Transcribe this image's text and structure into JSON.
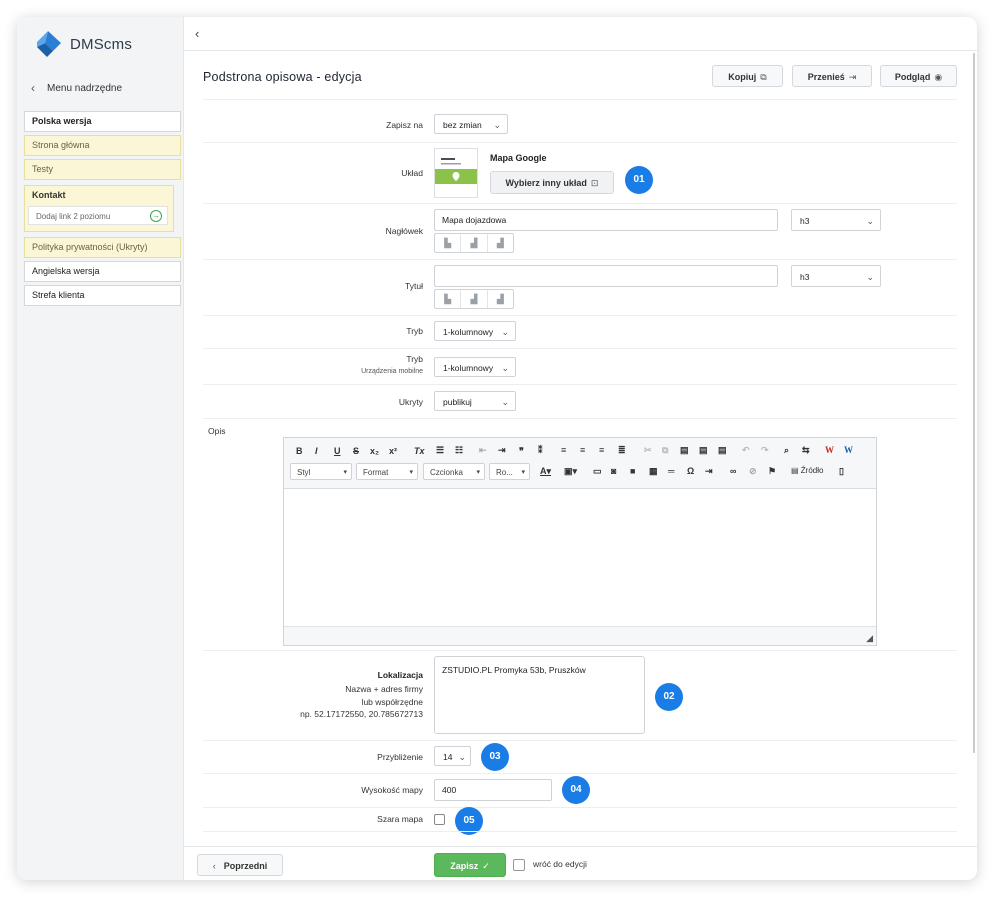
{
  "app": {
    "name": "DMScms"
  },
  "sidebar": {
    "back_label": "Menu nadrzędne",
    "items": [
      {
        "label": "Polska wersja"
      },
      {
        "label": "Strona główna"
      },
      {
        "label": "Testy"
      },
      {
        "label": "Kontakt"
      },
      {
        "label": "Dodaj link 2 poziomu"
      },
      {
        "label": "Polityka prywatności (Ukryty)"
      },
      {
        "label": "Angielska wersja"
      },
      {
        "label": "Strefa klienta"
      }
    ]
  },
  "header": {
    "title": "Podstrona opisowa - edycja",
    "copy_label": "Kopiuj",
    "move_label": "Przenieś",
    "preview_label": "Podgląd"
  },
  "form": {
    "save_to_label": "Zapisz na",
    "save_to_value": "bez zmian",
    "layout_label": "Układ",
    "layout_name": "Mapa Google",
    "choose_layout_label": "Wybierz inny układ",
    "heading_label": "Nagłówek",
    "heading_value": "Mapa dojazdowa",
    "heading_tag": "h3",
    "title_label": "Tytuł",
    "title_value": "",
    "title_tag": "h3",
    "mode_label": "Tryb",
    "mode_value": "1-kolumnowy",
    "mode_mobile_label": "Tryb",
    "mode_mobile_sub": "Urządzenia mobilne",
    "mode_mobile_value": "1-kolumnowy",
    "hidden_label": "Ukryty",
    "hidden_value": "publikuj",
    "description_label": "Opis",
    "location_label": "Lokalizacja",
    "location_hint1": "Nazwa + adres firmy",
    "location_hint2": "lub współrzędne",
    "location_hint3": "np. 52.17172550, 20.785672713",
    "location_value": "ZSTUDIO.PL Promyka 53b, Pruszków",
    "zoom_label": "Przybliżenie",
    "zoom_value": "14",
    "height_label": "Wysokość mapy",
    "height_value": "400",
    "gray_label": "Szara mapa"
  },
  "editor": {
    "style_label": "Styl",
    "format_label": "Format",
    "font_label": "Czcionka",
    "size_label": "Ro...",
    "source_label": "Źródło"
  },
  "badges": [
    "01",
    "02",
    "03",
    "04",
    "05"
  ],
  "footer": {
    "prev_label": "Poprzedni",
    "save_label": "Zapisz",
    "return_label": "wróć do edycji"
  },
  "colors": {
    "accent": "#1a7de6",
    "save": "#5cb85c",
    "highlight": "#fbf7d6"
  }
}
